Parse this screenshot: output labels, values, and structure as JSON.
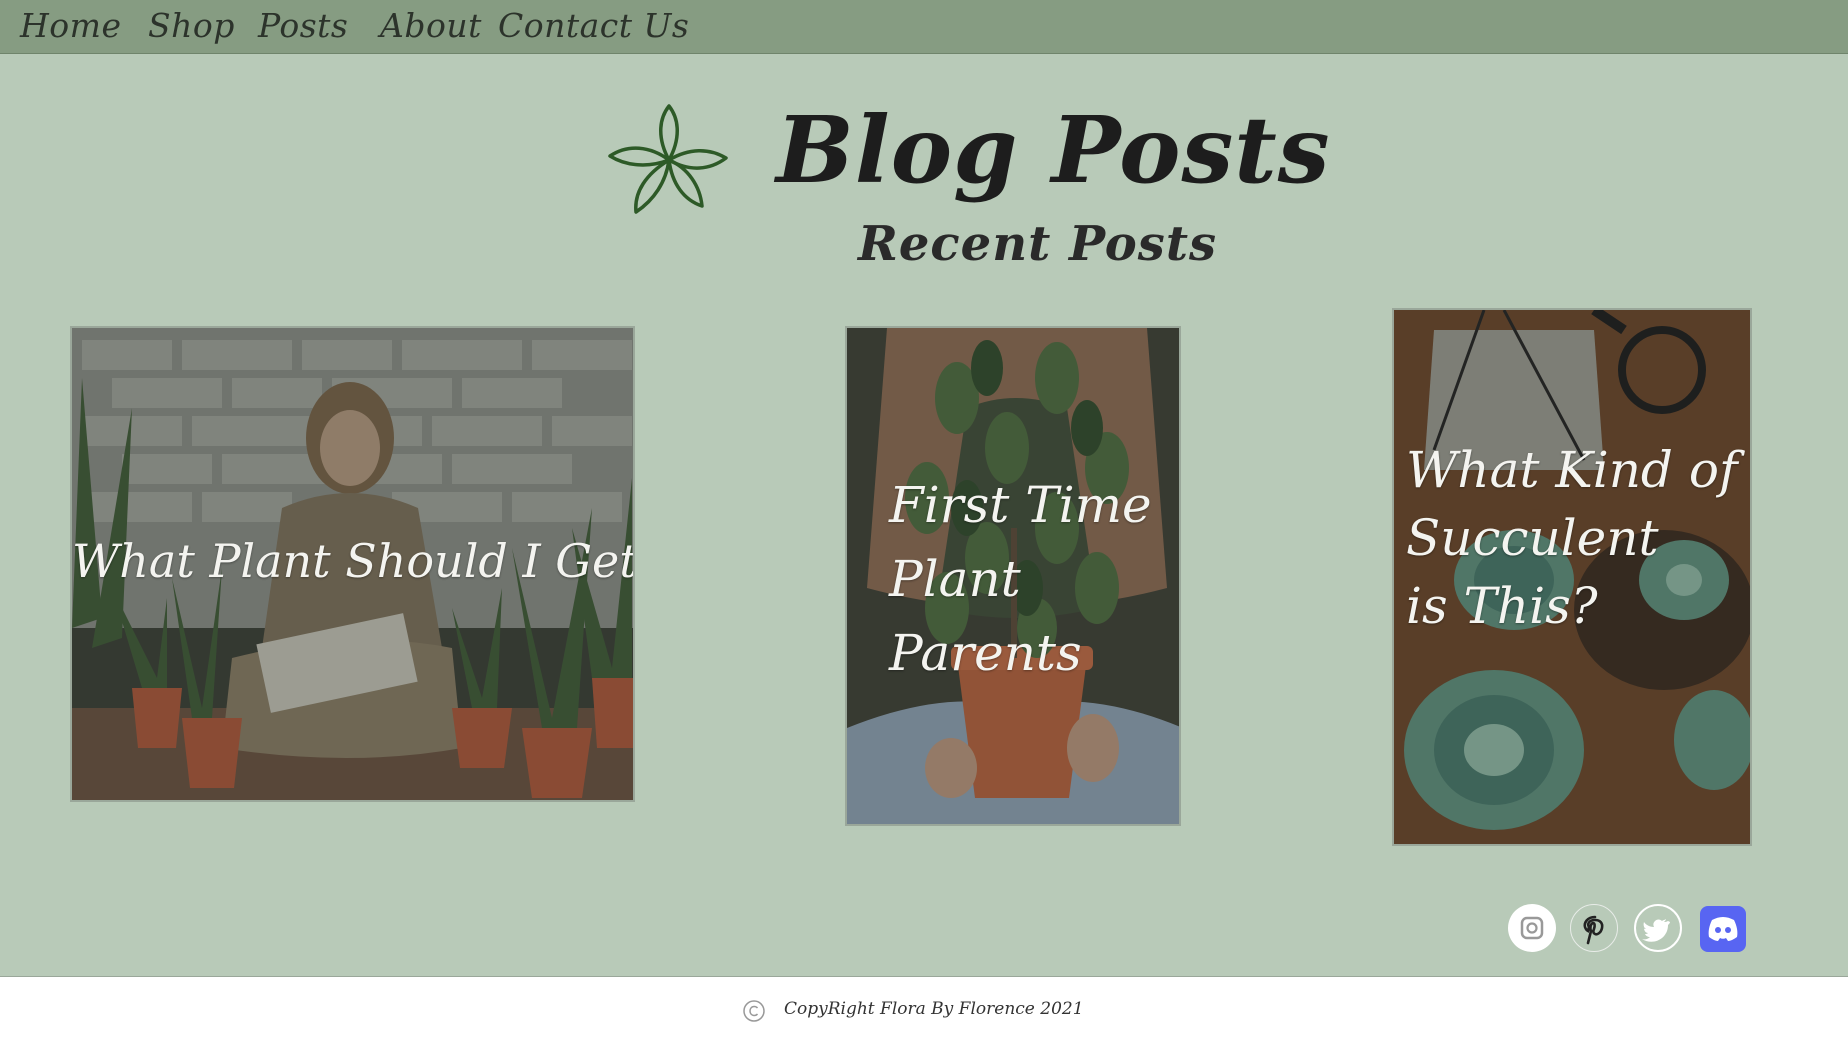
{
  "nav": {
    "items": [
      {
        "label": "Home"
      },
      {
        "label": "Shop"
      },
      {
        "label": "Posts"
      },
      {
        "label": "About"
      },
      {
        "label": "Contact Us"
      }
    ]
  },
  "header": {
    "title": "Blog Posts",
    "subtitle": "Recent Posts",
    "logo_icon": "flower-outline-icon"
  },
  "posts": [
    {
      "title": "What Plant Should I Get"
    },
    {
      "title_lines": [
        "First Time",
        "Plant",
        "Parents"
      ]
    },
    {
      "title_lines": [
        "What Kind of",
        "Succulent",
        "is This?"
      ]
    }
  ],
  "social": [
    {
      "icon": "instagram-icon"
    },
    {
      "icon": "pinterest-icon"
    },
    {
      "icon": "twitter-icon"
    },
    {
      "icon": "discord-icon"
    }
  ],
  "footer": {
    "copyright": "CopyRight Flora By Florence 2021"
  },
  "colors": {
    "background": "#b8cab8",
    "navbar": "#869c82",
    "logo_green": "#2d5a27",
    "discord": "#5865f2"
  }
}
